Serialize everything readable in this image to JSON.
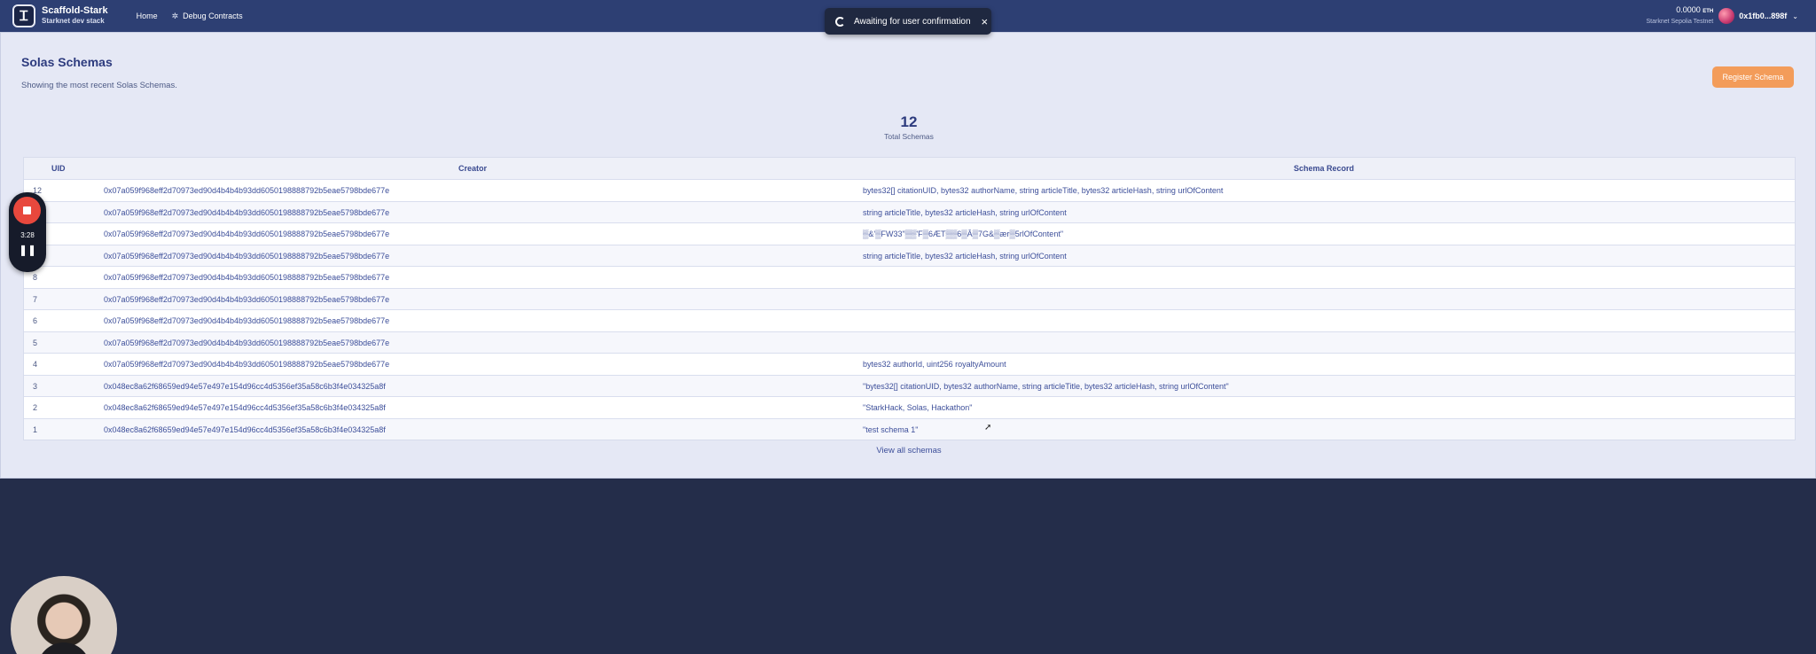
{
  "navbar": {
    "brand_title": "Scaffold-Stark",
    "brand_subtitle": "Starknet dev stack",
    "links": [
      "Home",
      "Debug Contracts"
    ],
    "balance": "0.0000",
    "balance_unit": "ETH",
    "network": "Starknet Sepolia Testnet",
    "address": "0x1fb0...898f"
  },
  "toast": {
    "message": "Awaiting for user confirmation"
  },
  "page": {
    "title": "Solas Schemas",
    "subtitle": "Showing the most recent Solas Schemas.",
    "register_button": "Register Schema",
    "total_count": "12",
    "total_label": "Total Schemas",
    "view_all": "View all schemas"
  },
  "table": {
    "headers": {
      "uid": "UID",
      "creator": "Creator",
      "record": "Schema Record"
    },
    "rows": [
      {
        "uid": "12",
        "creator": "0x07a059f968eff2d70973ed90d4b4b4b93dd6050198888792b5eae5798bde677e",
        "record": "bytes32[] citationUID, bytes32 authorName, string articleTitle, bytes32 articleHash, string urlOfContent"
      },
      {
        "uid": "11",
        "creator": "0x07a059f968eff2d70973ed90d4b4b4b93dd6050198888792b5eae5798bde677e",
        "record": "string articleTitle, bytes32 articleHash, string urlOfContent"
      },
      {
        "uid": "10",
        "creator": "0x07a059f968eff2d70973ed90d4b4b4b93dd6050198888792b5eae5798bde677e",
        "record": "▒&'▒FW33\"▒▒'F▒6ÆT▒▒6▒Â▒7G&▒ær▒5rlOfContent\""
      },
      {
        "uid": "9",
        "creator": "0x07a059f968eff2d70973ed90d4b4b4b93dd6050198888792b5eae5798bde677e",
        "record": "string articleTitle, bytes32 articleHash, string urlOfContent"
      },
      {
        "uid": "8",
        "creator": "0x07a059f968eff2d70973ed90d4b4b4b93dd6050198888792b5eae5798bde677e",
        "record": ""
      },
      {
        "uid": "7",
        "creator": "0x07a059f968eff2d70973ed90d4b4b4b93dd6050198888792b5eae5798bde677e",
        "record": ""
      },
      {
        "uid": "6",
        "creator": "0x07a059f968eff2d70973ed90d4b4b4b93dd6050198888792b5eae5798bde677e",
        "record": ""
      },
      {
        "uid": "5",
        "creator": "0x07a059f968eff2d70973ed90d4b4b4b93dd6050198888792b5eae5798bde677e",
        "record": ""
      },
      {
        "uid": "4",
        "creator": "0x07a059f968eff2d70973ed90d4b4b4b93dd6050198888792b5eae5798bde677e",
        "record": "bytes32 authorId, uint256 royaltyAmount"
      },
      {
        "uid": "3",
        "creator": "0x048ec8a62f68659ed94e57e497e154d96cc4d5356ef35a58c6b3f4e034325a8f",
        "record": "\"bytes32[] citationUID, bytes32 authorName, string articleTitle, bytes32 articleHash, string urlOfContent\""
      },
      {
        "uid": "2",
        "creator": "0x048ec8a62f68659ed94e57e497e154d96cc4d5356ef35a58c6b3f4e034325a8f",
        "record": "\"StarkHack, Solas, Hackathon\""
      },
      {
        "uid": "1",
        "creator": "0x048ec8a62f68659ed94e57e497e154d96cc4d5356ef35a58c6b3f4e034325a8f",
        "record": "\"test schema 1\""
      }
    ]
  },
  "recorder": {
    "time": "3:28"
  },
  "colors": {
    "navbar": "#2d3f73",
    "accent_button": "#f39c5a",
    "page_bg": "#e5e8f5",
    "footer_bg": "#242d4a"
  }
}
